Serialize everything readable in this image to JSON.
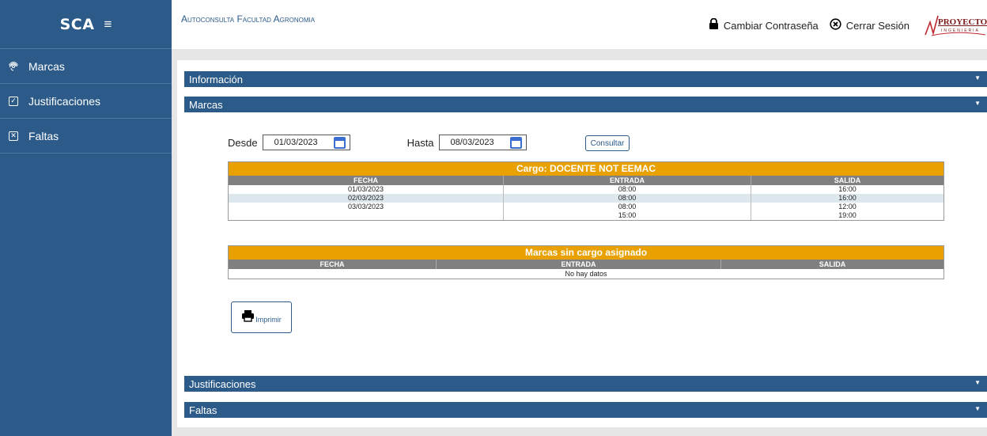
{
  "sidebar": {
    "brand": "SCA",
    "menu_icon": "hamburger-icon",
    "items": [
      {
        "label": "Marcas",
        "icon": "fingerprint-icon"
      },
      {
        "label": "Justificaciones",
        "icon": "checkbox-icon"
      },
      {
        "label": "Faltas",
        "icon": "x-box-icon"
      }
    ]
  },
  "header": {
    "title": "Autoconsulta Facultad Agronomia",
    "change_password": "Cambiar Contraseña",
    "logout": "Cerrar Sesión",
    "logo_text": "PROYECTOS",
    "logo_sub": "INGENIERIA"
  },
  "accordion": {
    "informacion": "Información",
    "marcas": "Marcas",
    "justificaciones": "Justificaciones",
    "faltas": "Faltas"
  },
  "filters": {
    "desde_label": "Desde",
    "desde_value": "01/03/2023",
    "hasta_label": "Hasta",
    "hasta_value": "08/03/2023",
    "consultar": "Consultar"
  },
  "table_cargo": {
    "caption": "Cargo: DOCENTE NOT EEMAC",
    "columns": [
      "FECHA",
      "ENTRADA",
      "SALIDA"
    ],
    "rows": [
      [
        "01/03/2023",
        "08:00",
        "16:00"
      ],
      [
        "02/03/2023",
        "08:00",
        "16:00"
      ],
      [
        "03/03/2023",
        "08:00",
        "12:00"
      ],
      [
        "",
        "15:00",
        "19:00"
      ]
    ]
  },
  "table_sin_cargo": {
    "caption": "Marcas sin cargo asignado",
    "columns": [
      "FECHA",
      "ENTRADA",
      "SALIDA"
    ],
    "empty_text": "No hay datos"
  },
  "print_button": "Imprimir",
  "colors": {
    "primary": "#2c5b8a",
    "accent": "#e8a100",
    "header_gray": "#808080"
  }
}
